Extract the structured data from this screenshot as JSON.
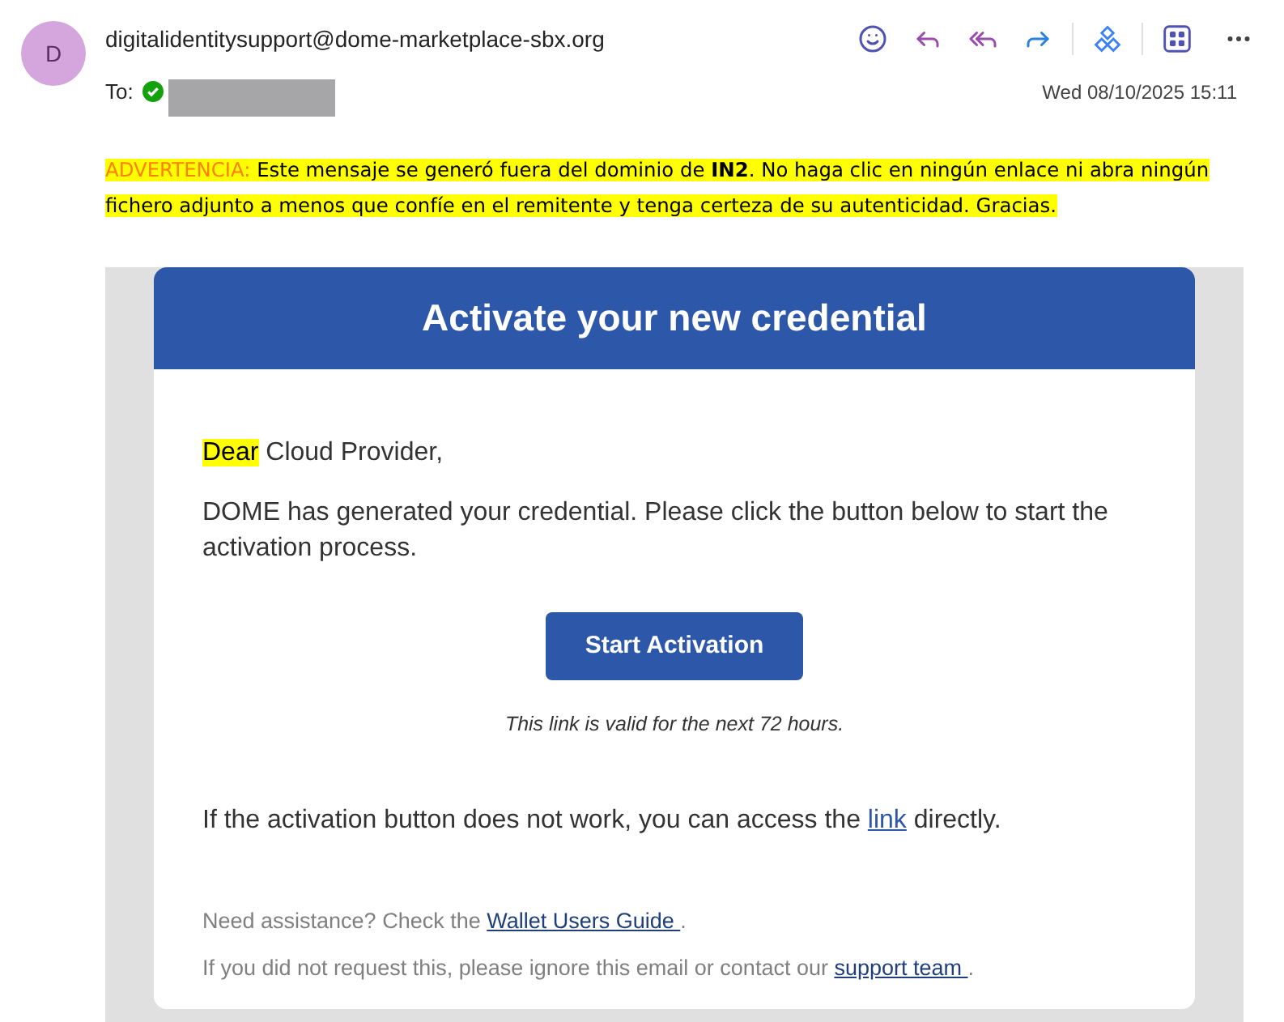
{
  "header": {
    "avatar_initial": "D",
    "sender": "digitalidentitysupport@dome-marketplace-sbx.org",
    "to_label": "To:",
    "recipient_verified": true,
    "date": "Wed 08/10/2025 15:11"
  },
  "warning": {
    "label": "ADVERTENCIA:",
    "text": "Este mensaje se generó fuera del dominio de **IN2**. No haga clic en ningún enlace ni abra ningún fichero adjunto a menos que confíe en el remitente y tenga certeza de su autenticidad. Gracias."
  },
  "email": {
    "title": "Activate your new credential",
    "greeting_highlight": "Dear",
    "greeting_rest": " Cloud Provider,",
    "intro": "DOME has generated your credential. Please click the button below to start the activation process.",
    "button": "Start Activation",
    "validity": "This link is valid for the next 72 hours.",
    "fallback": {
      "before": "If the activation button does not work, you can access the ",
      "link": "link",
      "after": " directly."
    },
    "footer": [
      {
        "before": "Need assistance? Check the ",
        "link": "Wallet Users Guide ",
        "after": "."
      },
      {
        "before": "If you did not request this, please ignore this email or contact our ",
        "link": "support team ",
        "after": "."
      }
    ]
  }
}
